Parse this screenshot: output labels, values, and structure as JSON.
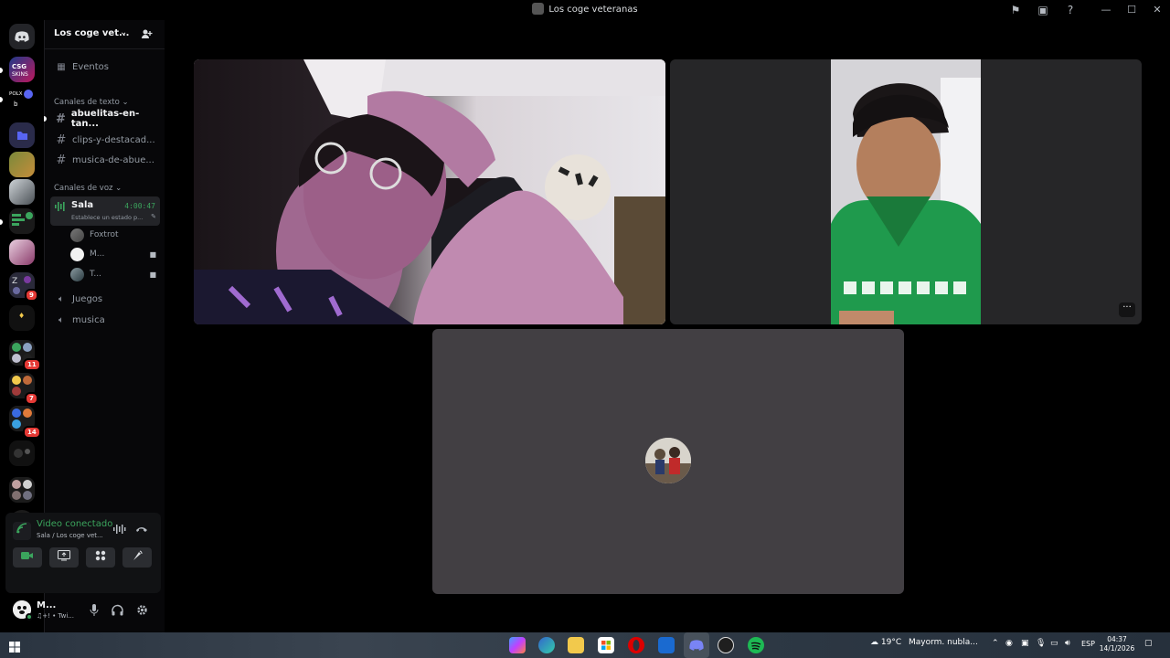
{
  "window": {
    "title": "Los coge veteranas"
  },
  "server": {
    "name": "Los coge vet...",
    "events_label": "Eventos"
  },
  "rail": {
    "home_icon": "discord-logo-icon",
    "pole_label": "POLX",
    "pole_sub": "b",
    "badges": [
      "9",
      "11",
      "7",
      "14"
    ],
    "add_icon": "plus-icon"
  },
  "text_category": "Canales de texto",
  "text_channels": [
    {
      "name": "abuelitas-en-tan...",
      "unread": true
    },
    {
      "name": "clips-y-destacad...",
      "unread": false
    },
    {
      "name": "musica-de-abue...",
      "unread": false
    }
  ],
  "voice_category": "Canales de voz",
  "voice_active": {
    "name": "Sala",
    "timer": "4:00:47",
    "status_placeholder": "Establece un estado p..."
  },
  "voice_members": [
    {
      "name": "Foxtrot",
      "camera": false
    },
    {
      "name": "M...",
      "camera": true
    },
    {
      "name": "T...",
      "camera": true
    }
  ],
  "voice_channels": [
    {
      "name": "Juegos"
    },
    {
      "name": "musica"
    }
  ],
  "voice_panel": {
    "title": "Video conectado",
    "subtitle": "Sala / Los coge vet..."
  },
  "user": {
    "name": "M...",
    "status": "♫+! • Twi..."
  },
  "taskbar": {
    "weather_temp": "19°C",
    "weather_text": "Mayorm. nubla...",
    "lang": "ESP",
    "time": "04:37",
    "date": "14/1/2026"
  },
  "colors": {
    "accent_green": "#3ba55d",
    "badge_red": "#e53935",
    "sidebar_bg": "#070709",
    "empty_tile": "#423f43"
  }
}
